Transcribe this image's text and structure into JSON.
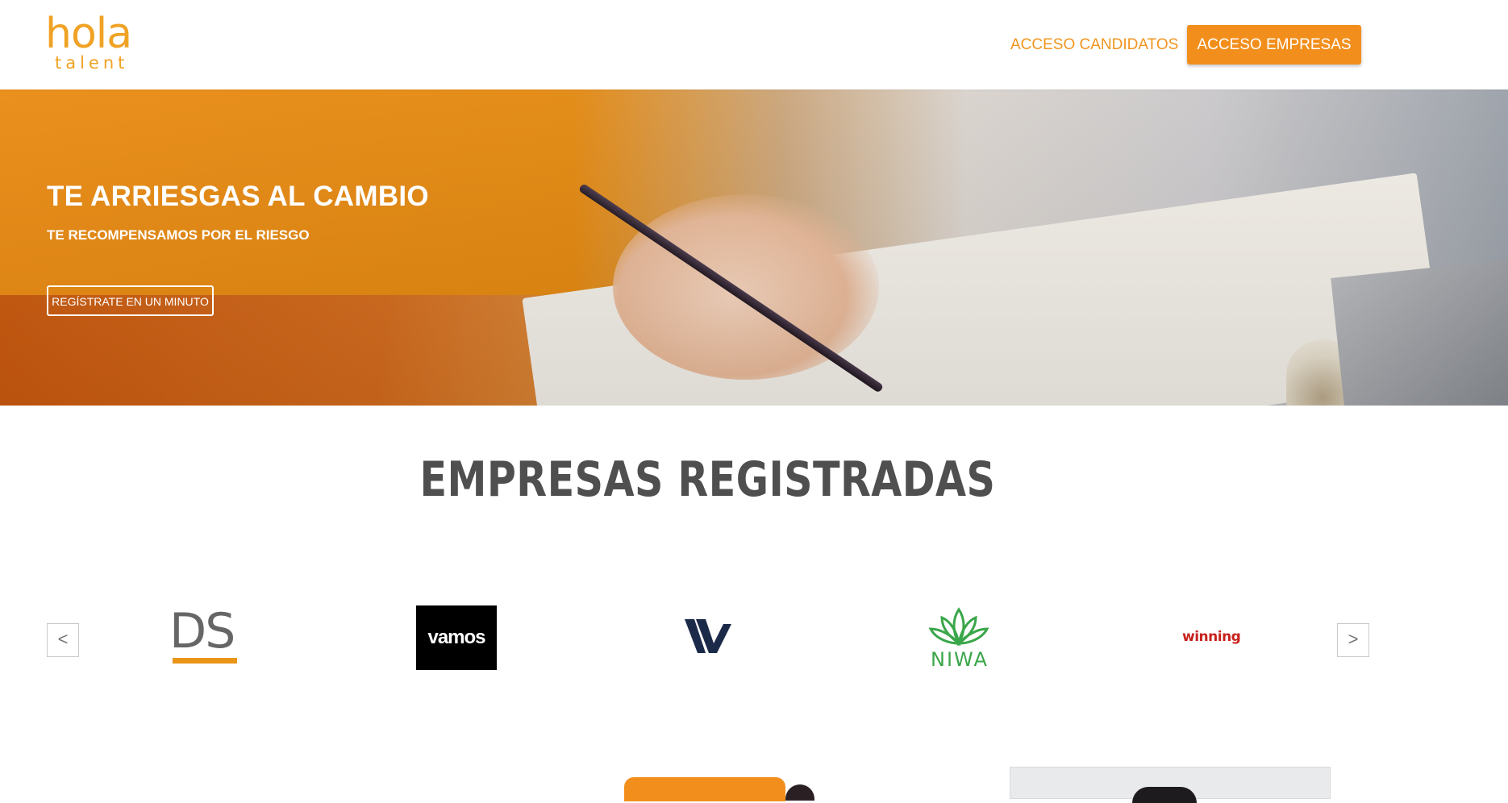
{
  "header": {
    "logo_top": "hola",
    "logo_bottom": "talent",
    "nav_candidatos": "ACCESO CANDIDATOS",
    "nav_empresas": "ACCESO EMPRESAS",
    "accent_color": "#f28f1c"
  },
  "hero": {
    "title": "TE ARRIESGAS AL CAMBIO",
    "subtitle": "TE RECOMPENSAMOS POR EL RIESGO",
    "cta": "REGÍSTRATE EN UN MINUTO"
  },
  "empresas": {
    "title": "EMPRESAS REGISTRADAS",
    "prev_arrow": "<",
    "next_arrow": ">",
    "logos": [
      {
        "name": "DS",
        "text": "DS"
      },
      {
        "name": "vamos",
        "text": "vamos"
      },
      {
        "name": "W",
        "text": ""
      },
      {
        "name": "niwa",
        "text": "NIWA"
      },
      {
        "name": "winning",
        "text": "winning"
      }
    ]
  }
}
